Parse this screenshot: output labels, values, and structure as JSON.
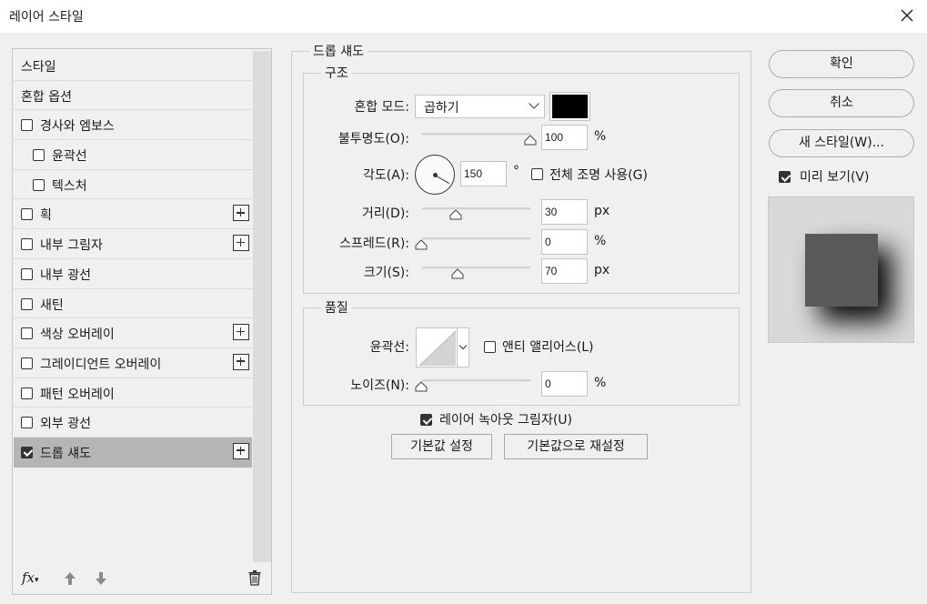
{
  "window": {
    "title": "레이어 스타일"
  },
  "left_list": {
    "items": [
      {
        "label": "스타일",
        "checkbox": false,
        "checked": false,
        "indent": false,
        "plus": false,
        "selected": false
      },
      {
        "label": "혼합 옵션",
        "checkbox": false,
        "checked": false,
        "indent": false,
        "plus": false,
        "selected": false
      },
      {
        "label": "경사와 엠보스",
        "checkbox": true,
        "checked": false,
        "indent": false,
        "plus": false,
        "selected": false
      },
      {
        "label": "윤곽선",
        "checkbox": true,
        "checked": false,
        "indent": true,
        "plus": false,
        "selected": false
      },
      {
        "label": "텍스처",
        "checkbox": true,
        "checked": false,
        "indent": true,
        "plus": false,
        "selected": false
      },
      {
        "label": "획",
        "checkbox": true,
        "checked": false,
        "indent": false,
        "plus": true,
        "selected": false
      },
      {
        "label": "내부 그림자",
        "checkbox": true,
        "checked": false,
        "indent": false,
        "plus": true,
        "selected": false
      },
      {
        "label": "내부 광선",
        "checkbox": true,
        "checked": false,
        "indent": false,
        "plus": false,
        "selected": false
      },
      {
        "label": "새틴",
        "checkbox": true,
        "checked": false,
        "indent": false,
        "plus": false,
        "selected": false
      },
      {
        "label": "색상 오버레이",
        "checkbox": true,
        "checked": false,
        "indent": false,
        "plus": true,
        "selected": false
      },
      {
        "label": "그레이디언트 오버레이",
        "checkbox": true,
        "checked": false,
        "indent": false,
        "plus": true,
        "selected": false
      },
      {
        "label": "패턴 오버레이",
        "checkbox": true,
        "checked": false,
        "indent": false,
        "plus": false,
        "selected": false
      },
      {
        "label": "외부 광선",
        "checkbox": true,
        "checked": false,
        "indent": false,
        "plus": false,
        "selected": false
      },
      {
        "label": "드롭 섀도",
        "checkbox": true,
        "checked": true,
        "indent": false,
        "plus": true,
        "selected": true
      }
    ],
    "footer": {
      "fx_label": "fx"
    }
  },
  "drop_shadow": {
    "section_title": "드롭 섀도",
    "structure": {
      "title": "구조",
      "blend_mode_label": "혼합 모드:",
      "blend_mode_value": "곱하기",
      "shadow_color": "#000000",
      "opacity_label": "불투명도(O):",
      "opacity_value": "100",
      "opacity_unit": "%",
      "angle_label": "각도(A):",
      "angle_value": "150",
      "angle_unit": "°",
      "global_light_label": "전체 조명 사용(G)",
      "global_light_checked": false,
      "distance_label": "거리(D):",
      "distance_value": "30",
      "distance_unit": "px",
      "spread_label": "스프레드(R):",
      "spread_value": "0",
      "spread_unit": "%",
      "size_label": "크기(S):",
      "size_value": "70",
      "size_unit": "px"
    },
    "quality": {
      "title": "품질",
      "contour_label": "윤곽선:",
      "anti_alias_label": "앤티 앨리어스(L)",
      "anti_alias_checked": false,
      "noise_label": "노이즈(N):",
      "noise_value": "0",
      "noise_unit": "%"
    },
    "knockout_label": "레이어 녹아웃 그림자(U)",
    "knockout_checked": true,
    "make_default_button": "기본값 설정",
    "reset_default_button": "기본값으로 재설정"
  },
  "right_panel": {
    "ok_button": "확인",
    "cancel_button": "취소",
    "new_style_button": "새 스타일(W)...",
    "preview_label": "미리 보기(V)",
    "preview_checked": true
  }
}
